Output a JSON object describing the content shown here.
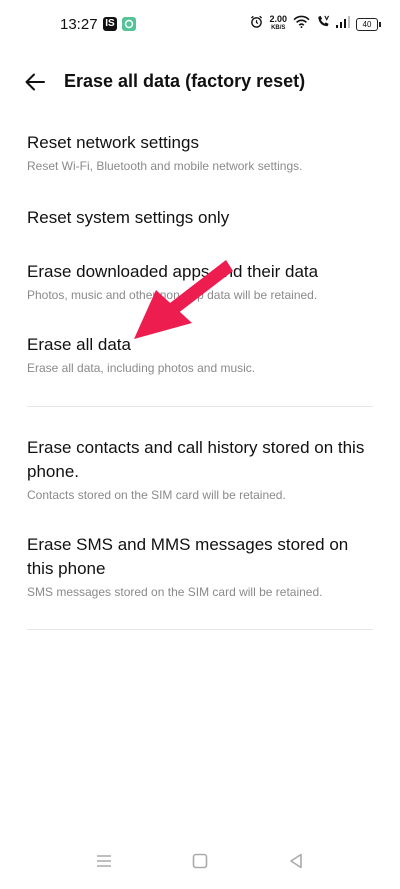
{
  "status_bar": {
    "time": "13:27",
    "app_badges": [
      "IS",
      ""
    ],
    "net_speed_value": "2.00",
    "net_speed_unit": "KB/S",
    "battery_level": "40",
    "icons": [
      "alarm-icon",
      "wifi-icon",
      "volte-call-icon",
      "signal-icon",
      "battery-icon"
    ]
  },
  "header": {
    "title": "Erase all data (factory reset)",
    "back_icon": "back-arrow-icon"
  },
  "items": [
    {
      "title": "Reset network settings",
      "subtitle": "Reset Wi-Fi, Bluetooth and mobile network settings."
    },
    {
      "title": "Reset system settings only",
      "subtitle": ""
    },
    {
      "title": "Erase downloaded apps and their data",
      "subtitle": "Photos, music and other non-app data will be retained."
    },
    {
      "title": "Erase all data",
      "subtitle": "Erase all data, including photos and music."
    },
    {
      "title": "Erase contacts and call history stored on this phone.",
      "subtitle": "Contacts stored on the SIM card will be retained."
    },
    {
      "title": "Erase SMS and MMS messages stored on this phone",
      "subtitle": "SMS messages stored on the SIM card will be retained."
    }
  ],
  "nav_bar": {
    "icons": [
      "menu-icon",
      "home-icon",
      "back-icon"
    ]
  },
  "colors": {
    "annotation_arrow": "#ee1d4f",
    "subtitle_text": "#8a8a8a",
    "divider": "#e6e6e6"
  }
}
